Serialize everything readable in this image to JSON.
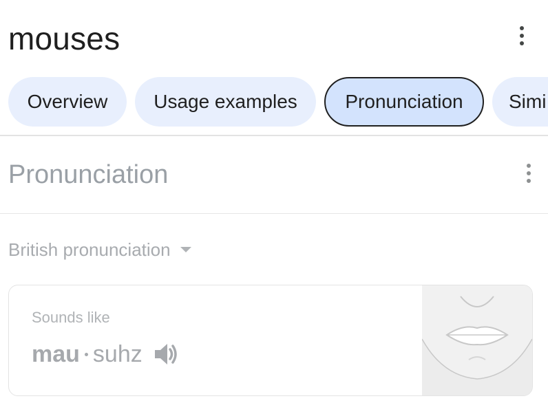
{
  "header": {
    "title": "mouses",
    "more_icon": "more-vert-icon"
  },
  "tabs": [
    {
      "label": "Overview",
      "selected": false
    },
    {
      "label": "Usage examples",
      "selected": false
    },
    {
      "label": "Pronunciation",
      "selected": true
    },
    {
      "label": "Simi",
      "selected": false
    }
  ],
  "section": {
    "title": "Pronunciation",
    "more_icon": "more-vert-icon"
  },
  "accent_selector": {
    "value": "British pronunciation",
    "icon": "caret-down-icon"
  },
  "card": {
    "sounds_like_label": "Sounds like",
    "syllables": [
      {
        "text": "mau",
        "stressed": true
      },
      {
        "text": "suhz",
        "stressed": false
      }
    ],
    "speaker_icon": "speaker-icon",
    "illustration": "mouth-illustration"
  },
  "colors": {
    "chip_bg": "#e8effd",
    "chip_selected_bg": "#d3e3fd",
    "text_primary": "#1f1f1f",
    "text_muted": "#9aa0a6"
  }
}
